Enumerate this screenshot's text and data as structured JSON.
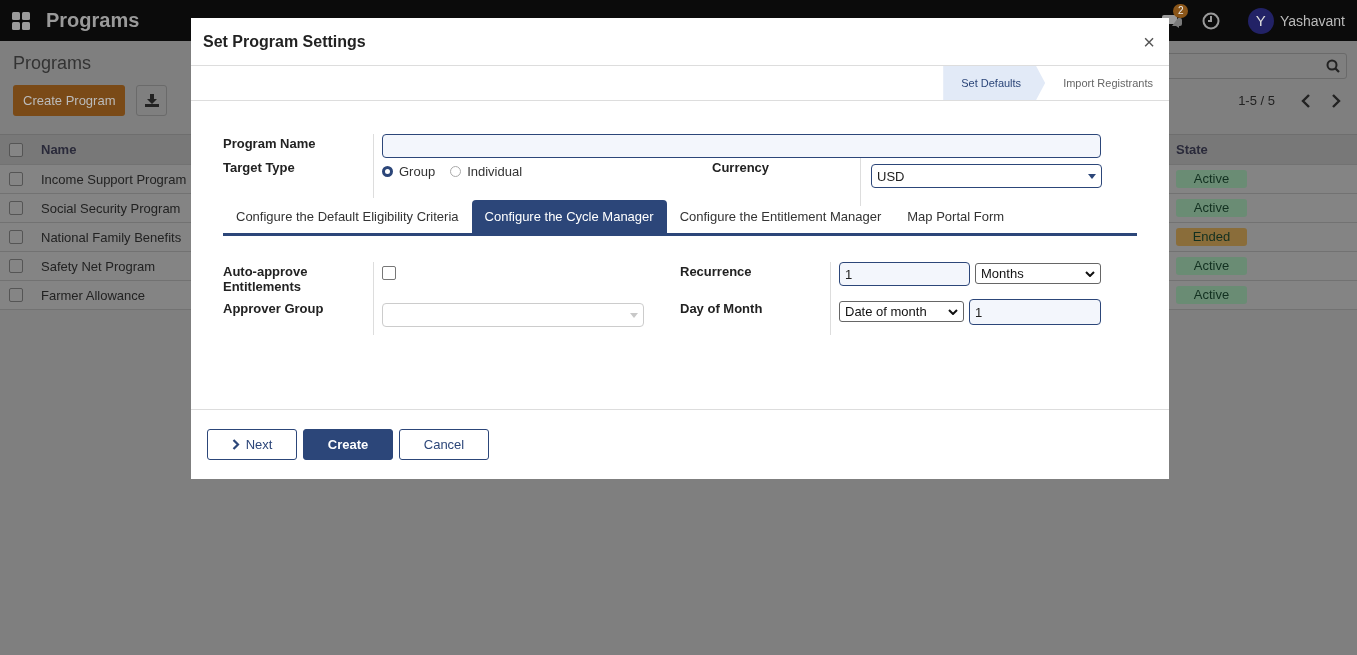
{
  "app_bar": {
    "app_name": "Programs",
    "messages_badge": "2",
    "user": {
      "initial": "Y",
      "name": "Yashavant"
    }
  },
  "control_panel": {
    "breadcrumb": "Programs",
    "create_button": "Create Program",
    "pager": "1-5 / 5"
  },
  "list": {
    "columns": [
      "Name",
      "State"
    ],
    "all_checked": false,
    "rows": [
      {
        "name": "Income Support Program",
        "state": "Active",
        "color": "#6a8c74",
        "checked": false
      },
      {
        "name": "Social Security Program",
        "state": "Active",
        "color": "#6a8c74",
        "checked": false
      },
      {
        "name": "National Family Benefits",
        "state": "Ended",
        "color": "#8a6d3a",
        "checked": false
      },
      {
        "name": "Safety Net Program",
        "state": "Active",
        "color": "#6a8c74",
        "checked": false
      },
      {
        "name": "Farmer Allowance",
        "state": "Active",
        "color": "#6a8c74",
        "checked": false
      }
    ]
  },
  "dialog": {
    "title": "Set Program Settings",
    "close": "×",
    "steps": [
      {
        "label": "Set Defaults",
        "selected": true
      },
      {
        "label": "Import Registrants",
        "selected": false
      }
    ],
    "program_name": {
      "label": "Program Name"
    },
    "target_type": {
      "label": "Target Type",
      "options": [
        {
          "label": "Group",
          "selected": true
        },
        {
          "label": "Individual",
          "selected": false
        }
      ]
    },
    "currency": {
      "label": "Currency",
      "value": "USD"
    },
    "tabs": [
      {
        "label": "Configure the Default Eligibility Criteria",
        "selected": false
      },
      {
        "label": "Configure the Cycle Manager",
        "selected": true
      },
      {
        "label": "Configure the Entitlement Manager",
        "selected": false
      },
      {
        "label": "Map Portal Form",
        "selected": false
      }
    ],
    "auto_approve": {
      "label": "Auto-approve Entitlements",
      "checked": false
    },
    "approver_group": {
      "label": "Approver Group"
    },
    "recurrence": {
      "label": "Recurrence",
      "value": "1",
      "unit": "Months"
    },
    "day_of_month": {
      "label": "Day of Month",
      "mode": "Date of month",
      "value": "1"
    },
    "buttons": [
      {
        "label": "Next",
        "kind": "next"
      },
      {
        "label": "Create",
        "kind": "primary"
      },
      {
        "label": "Cancel",
        "kind": "secondary"
      }
    ]
  }
}
